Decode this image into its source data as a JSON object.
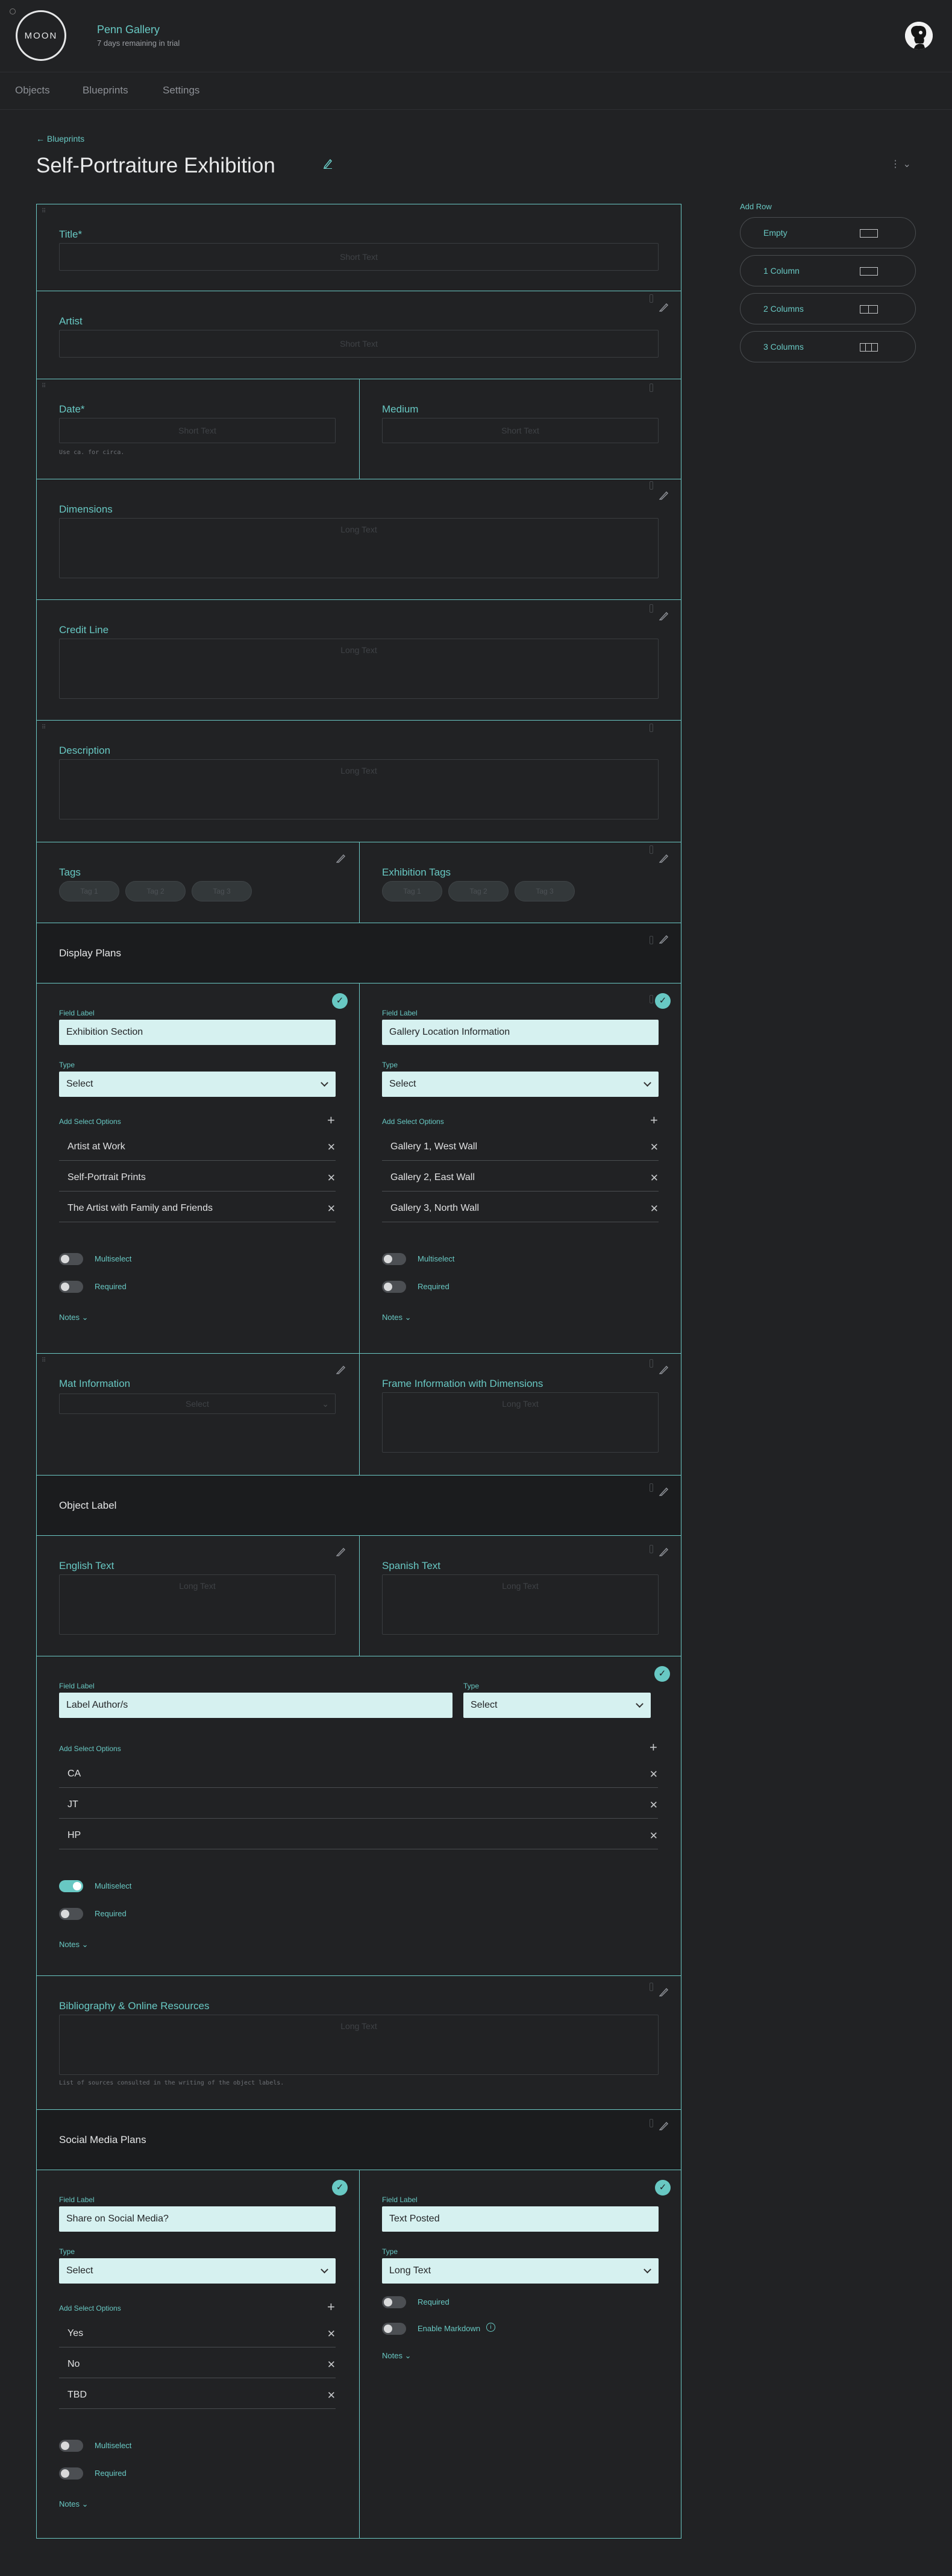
{
  "app": {
    "logo_text": "MOON",
    "org_name": "Penn Gallery",
    "trial_text": "7 days remaining in trial"
  },
  "nav": {
    "tabs": [
      "Objects",
      "Blueprints",
      "Settings"
    ]
  },
  "breadcrumb": "Blueprints",
  "page_title": "Self-Portraiture Exhibition",
  "sidebar": {
    "title": "Add Row",
    "items": [
      {
        "label": "Empty",
        "icon": "empty-row-icon"
      },
      {
        "label": "1 Column",
        "icon": "one-column-icon"
      },
      {
        "label": "2 Columns",
        "icon": "two-columns-icon"
      },
      {
        "label": "3 Columns",
        "icon": "three-columns-icon"
      }
    ]
  },
  "fields": {
    "title": {
      "label": "Title*",
      "placeholder": "Short Text"
    },
    "artist": {
      "label": "Artist",
      "placeholder": "Short Text"
    },
    "date": {
      "label": "Date*",
      "placeholder": "Short Text",
      "hint": "Use ca. for circa."
    },
    "medium": {
      "label": "Medium",
      "placeholder": "Short Text"
    },
    "dimensions": {
      "label": "Dimensions",
      "placeholder": "Long Text"
    },
    "credit_line": {
      "label": "Credit Line",
      "placeholder": "Long Text"
    },
    "description": {
      "label": "Description",
      "placeholder": "Long Text"
    },
    "tags": {
      "label": "Tags",
      "tags": [
        "Tag 1",
        "Tag 2",
        "Tag 3"
      ]
    },
    "exhibition_tags": {
      "label": "Exhibition Tags",
      "tags": [
        "Tag 1",
        "Tag 2",
        "Tag 3"
      ]
    },
    "mat_info": {
      "label": "Mat Information",
      "placeholder": "Select"
    },
    "frame_info": {
      "label": "Frame Information with Dimensions",
      "placeholder": "Long Text"
    },
    "english_text": {
      "label": "English Text",
      "placeholder": "Long Text"
    },
    "spanish_text": {
      "label": "Spanish Text",
      "placeholder": "Long Text"
    },
    "bibliography": {
      "label": "Bibliography & Online Resources",
      "placeholder": "Long Text",
      "hint": "List of sources consulted in the writing of the object labels."
    }
  },
  "sections": {
    "display_plans": "Display Plans",
    "object_label": "Object Label",
    "social_media": "Social Media Plans"
  },
  "editor": {
    "field_label": "Field Label",
    "type_label": "Type",
    "add_options_label": "Add Select Options",
    "multiselect_label": "Multiselect",
    "required_label": "Required",
    "markdown_label": "Enable Markdown",
    "notes_label": "Notes"
  },
  "exhibition_section": {
    "value": "Exhibition Section",
    "type": "Select",
    "options": [
      "Artist at Work",
      "Self-Portrait Prints",
      "The Artist with Family and Friends"
    ],
    "multiselect": false,
    "required": false
  },
  "gallery_location": {
    "value": "Gallery Location Information",
    "type": "Select",
    "options": [
      "Gallery 1, West Wall",
      "Gallery 2, East Wall",
      "Gallery 3, North Wall"
    ],
    "multiselect": false,
    "required": false
  },
  "label_authors": {
    "value": "Label Author/s",
    "type": "Select",
    "options": [
      "CA",
      "JT",
      "HP"
    ],
    "multiselect": true,
    "required": false
  },
  "share_social": {
    "value": "Share on Social Media?",
    "type": "Select",
    "options": [
      "Yes",
      "No",
      "TBD"
    ],
    "multiselect": false,
    "required": false
  },
  "text_posted": {
    "value": "Text Posted",
    "type": "Long Text",
    "required": false,
    "markdown": false
  },
  "colors": {
    "accent": "#68c8c3",
    "background": "#212224",
    "input_bg": "#d6f1f0"
  }
}
